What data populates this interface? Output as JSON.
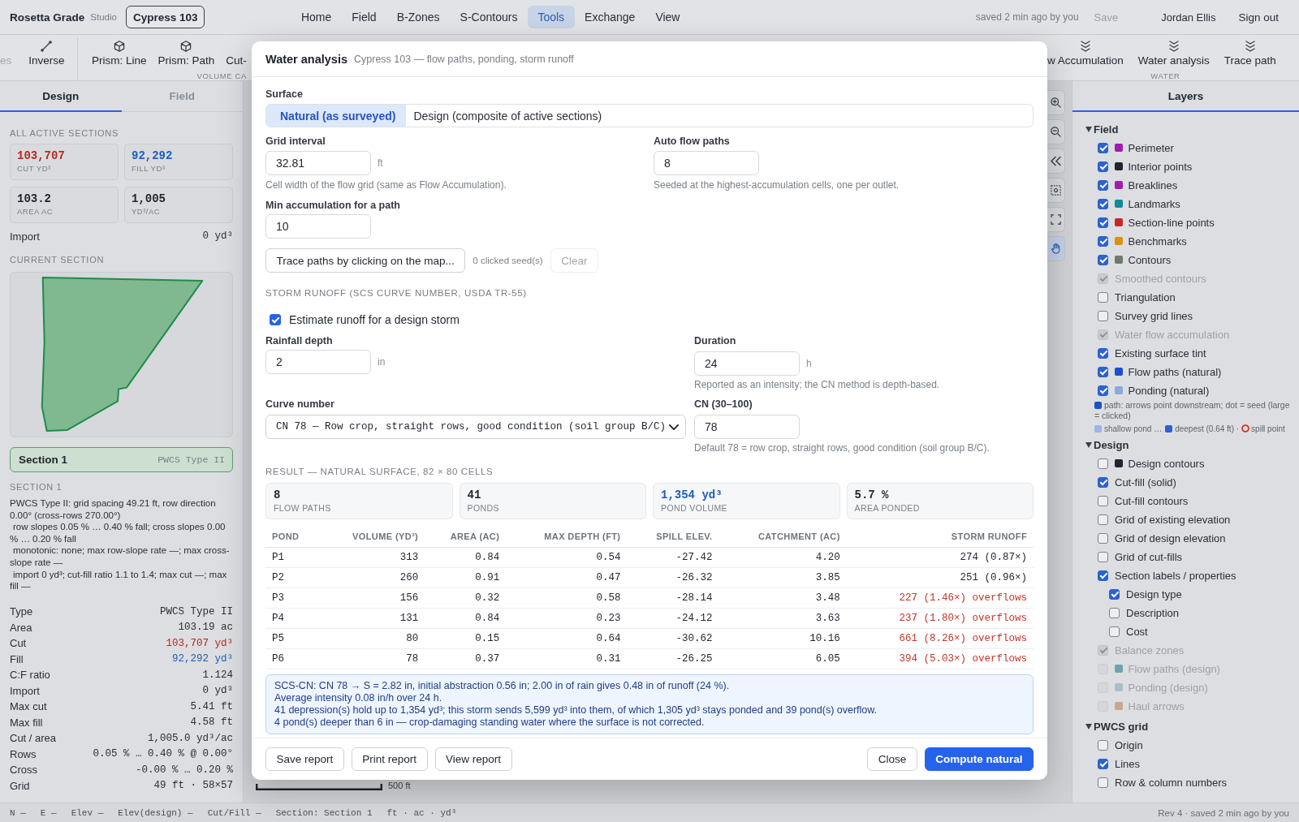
{
  "app": {
    "name": "Rosetta Grade",
    "edition": "Studio",
    "project": "Cypress 103"
  },
  "nav": [
    {
      "label": "Home",
      "selected": false
    },
    {
      "label": "Field",
      "selected": false
    },
    {
      "label": "B-Zones",
      "selected": false
    },
    {
      "label": "S-Contours",
      "selected": false
    },
    {
      "label": "Tools",
      "selected": true
    },
    {
      "label": "Exchange",
      "selected": false
    },
    {
      "label": "View",
      "selected": false
    }
  ],
  "account": {
    "save_status": "saved 2 min ago by you",
    "save": {
      "label": "Save",
      "disabled": true
    },
    "user": "Jordan Ellis",
    "sign_out": "Sign out"
  },
  "toolbar": {
    "groups": [
      {
        "items": [
          {
            "label": "es",
            "kind": "none",
            "disabled": true
          },
          {
            "label": "Inverse",
            "kind": "segment",
            "disabled": false
          }
        ]
      },
      {
        "label": "VOLUME CA",
        "items": [
          {
            "label": "Prism: Line",
            "kind": "prism",
            "disabled": false
          },
          {
            "label": "Prism: Path",
            "kind": "prism",
            "disabled": false
          },
          {
            "label": "Cut-",
            "kind": "none",
            "disabled": false
          }
        ]
      },
      {
        "label": "WATER",
        "items": [
          {
            "label": "w Accumulation",
            "kind": "flow",
            "disabled": false
          },
          {
            "label": "Water analysis",
            "kind": "flow",
            "disabled": false
          },
          {
            "label": "Trace path",
            "kind": "flow",
            "disabled": false
          }
        ]
      }
    ]
  },
  "left_panel": {
    "tabs": [
      {
        "label": "Design",
        "selected": true
      },
      {
        "label": "Field",
        "selected": false
      }
    ],
    "totals_heading": "ALL ACTIVE SECTIONS",
    "totals": [
      {
        "value": "103,707",
        "label": "CUT YD³",
        "kind": "cut"
      },
      {
        "value": "92,292",
        "label": "FILL YD³",
        "kind": "fill"
      },
      {
        "value": "103.2",
        "label": "AREA AC",
        "kind": "plain"
      },
      {
        "value": "1,005",
        "label": "YD³/AC",
        "kind": "plain"
      }
    ],
    "import_total": {
      "label": "Import",
      "value": "0 yd³"
    },
    "current_heading": "CURRENT SECTION",
    "sections": [
      {
        "name": "Section 1",
        "type": "PWCS Type II",
        "selected": true
      }
    ],
    "detail_heading": "SECTION 1",
    "summary_lines": [
      "PWCS Type II: grid spacing 49.21 ft, row direction 0.00° (cross-rows 270.00°)",
      "row slopes 0.05 % … 0.40 % fall; cross slopes 0.00 % … 0.20 % fall",
      "monotonic: none; max row-slope rate —; max cross-slope rate —",
      "import 0 yd³; cut-fill ratio 1.1 to 1.4; max cut —; max fill —"
    ],
    "properties": [
      {
        "label": "Type",
        "value": "PWCS Type II",
        "kind": "plain"
      },
      {
        "label": "Area",
        "value": "103.19 ac",
        "kind": "plain"
      },
      {
        "label": "Cut",
        "value": "103,707 yd³",
        "kind": "cut"
      },
      {
        "label": "Fill",
        "value": "92,292 yd³",
        "kind": "fill"
      },
      {
        "label": "C:F ratio",
        "value": "1.124",
        "kind": "plain"
      },
      {
        "label": "Import",
        "value": "0 yd³",
        "kind": "plain"
      },
      {
        "label": "Max cut",
        "value": "5.41 ft",
        "kind": "plain"
      },
      {
        "label": "Max fill",
        "value": "4.58 ft",
        "kind": "plain"
      },
      {
        "label": "Cut / area",
        "value": "1,005.0 yd³/ac",
        "kind": "plain"
      },
      {
        "label": "Rows",
        "value": "0.05 % … 0.40 % @ 0.00°",
        "kind": "plain"
      },
      {
        "label": "Cross",
        "value": "-0.00 % … 0.20 %",
        "kind": "plain"
      },
      {
        "label": "Grid",
        "value": "49 ft · 58×57",
        "kind": "plain"
      }
    ]
  },
  "map": {
    "controls": [
      {
        "kind": "zoom-in",
        "selected": false
      },
      {
        "kind": "zoom-out",
        "selected": false
      },
      {
        "kind": "collapse",
        "selected": false
      },
      {
        "kind": "box-select",
        "selected": false
      },
      {
        "kind": "fit",
        "selected": false
      },
      {
        "kind": "pan",
        "selected": true
      }
    ],
    "scale": "500 ft"
  },
  "dialog": {
    "title": "Water analysis",
    "subtitle": "Cypress 103 — flow paths, ponding, storm runoff",
    "surface": {
      "label": "Surface",
      "options": [
        {
          "label": "Natural (as surveyed)",
          "selected": true
        },
        {
          "label": "Design (composite of active sections)",
          "selected": false
        }
      ]
    },
    "grid_interval": {
      "label": "Grid interval",
      "value": "32.81",
      "unit": "ft",
      "help": "Cell width of the flow grid (same as Flow Accumulation)."
    },
    "auto_flow_paths": {
      "label": "Auto flow paths",
      "value": "8",
      "help": "Seeded at the highest-accumulation cells, one per outlet."
    },
    "min_accumulation": {
      "label": "Min accumulation for a path",
      "value": "10"
    },
    "trace": {
      "button": "Trace paths by clicking on the map...",
      "seed_count": "0 clicked seed(s)",
      "clear": {
        "label": "Clear",
        "disabled": true
      }
    },
    "storm_heading": "STORM RUNOFF (SCS CURVE NUMBER, USDA TR-55)",
    "estimate": {
      "label": "Estimate runoff for a design storm",
      "checked": true
    },
    "rainfall": {
      "label": "Rainfall depth",
      "value": "2",
      "unit": "in"
    },
    "duration": {
      "label": "Duration",
      "value": "24",
      "unit": "h",
      "help": "Reported as an intensity; the CN method is depth-based."
    },
    "curve_number": {
      "label": "Curve number",
      "value": "CN 78 — Row crop, straight rows, good condition (soil group B/C)"
    },
    "cn": {
      "label": "CN (30–100)",
      "value": "78",
      "help": "Default 78 = row crop, straight rows, good condition (soil group B/C)."
    },
    "result_heading": "RESULT — NATURAL SURFACE, 82 × 80 CELLS",
    "result_stats": [
      {
        "value": "8",
        "label": "FLOW PATHS",
        "kind": "plain"
      },
      {
        "value": "41",
        "label": "PONDS",
        "kind": "plain"
      },
      {
        "value": "1,354 yd³",
        "label": "POND VOLUME",
        "kind": "fill"
      },
      {
        "value": "5.7 %",
        "label": "AREA PONDED",
        "kind": "plain"
      }
    ],
    "table": {
      "columns": [
        "POND",
        "VOLUME (YD³)",
        "AREA (AC)",
        "MAX DEPTH (FT)",
        "SPILL ELEV.",
        "CATCHMENT (AC)",
        "STORM RUNOFF"
      ],
      "rows": [
        {
          "cells": [
            "P1",
            "313",
            "0.84",
            "0.54",
            "-27.42",
            "4.20",
            "274 (0.87×)"
          ],
          "overflow": false
        },
        {
          "cells": [
            "P2",
            "260",
            "0.91",
            "0.47",
            "-26.32",
            "3.85",
            "251 (0.96×)"
          ],
          "overflow": false
        },
        {
          "cells": [
            "P3",
            "156",
            "0.32",
            "0.58",
            "-28.14",
            "3.48",
            "227 (1.46×) overflows"
          ],
          "overflow": true
        },
        {
          "cells": [
            "P4",
            "131",
            "0.84",
            "0.23",
            "-24.12",
            "3.63",
            "237 (1.80×) overflows"
          ],
          "overflow": true
        },
        {
          "cells": [
            "P5",
            "80",
            "0.15",
            "0.64",
            "-30.62",
            "10.16",
            "661 (8.26×) overflows"
          ],
          "overflow": true
        },
        {
          "cells": [
            "P6",
            "78",
            "0.37",
            "0.31",
            "-26.25",
            "6.05",
            "394 (5.03×) overflows"
          ],
          "overflow": true
        }
      ]
    },
    "note": [
      "SCS-CN: CN 78 → S = 2.82 in, initial abstraction 0.56 in; 2.00 in of rain gives 0.48 in of runoff (24 %).",
      "Average intensity 0.08 in/h over 24 h.",
      "41 depression(s) hold up to 1,354 yd³; this storm sends 5,599 yd³ into them, of which 1,305 yd³ stays ponded and 39 pond(s) overflow.",
      "4 pond(s) deeper than 6 in — crop-damaging standing water where the surface is not corrected."
    ],
    "footer": {
      "left": [
        {
          "label": "Save report",
          "kind": "secondary"
        },
        {
          "label": "Print report",
          "kind": "secondary"
        },
        {
          "label": "View report",
          "kind": "secondary"
        }
      ],
      "right": [
        {
          "label": "Close",
          "kind": "secondary"
        },
        {
          "label": "Compute natural",
          "kind": "primary"
        }
      ]
    }
  },
  "layers_panel": {
    "title": "Layers",
    "groups": [
      {
        "label": "Field",
        "expanded": true,
        "items": [
          {
            "label": "Perimeter",
            "checked": true,
            "disabled": false,
            "color": "#a21caf"
          },
          {
            "label": "Interior points",
            "checked": true,
            "disabled": false,
            "color": "#1f2430"
          },
          {
            "label": "Breaklines",
            "checked": true,
            "disabled": false,
            "color": "#a21caf"
          },
          {
            "label": "Landmarks",
            "checked": true,
            "disabled": false,
            "color": "#0f8b99"
          },
          {
            "label": "Section-line points",
            "checked": true,
            "disabled": false,
            "color": "#c62828"
          },
          {
            "label": "Benchmarks",
            "checked": true,
            "disabled": false,
            "color": "#d69413"
          },
          {
            "label": "Contours",
            "checked": true,
            "disabled": false,
            "color": "#6e7b6c"
          },
          {
            "label": "Smoothed contours",
            "checked": true,
            "disabled": true
          },
          {
            "label": "Triangulation",
            "checked": false,
            "disabled": false
          },
          {
            "label": "Survey grid lines",
            "checked": false,
            "disabled": false
          },
          {
            "label": "Water flow accumulation",
            "checked": true,
            "disabled": true
          },
          {
            "label": "Existing surface tint",
            "checked": true,
            "disabled": false
          },
          {
            "label": "Flow paths (natural)",
            "checked": true,
            "disabled": false,
            "color": "#1e4fd0"
          },
          {
            "label": "Ponding (natural)",
            "checked": true,
            "disabled": false,
            "color": "#8ea7df"
          }
        ],
        "legend": [
          {
            "entries": [
              {
                "kind": "square",
                "color": "#1e4fd0",
                "text": "path: arrows point downstream; dot = seed (large = clicked)"
              }
            ]
          },
          {
            "entries": [
              {
                "kind": "square",
                "color": "#9db4e4",
                "text": "shallow pond …"
              },
              {
                "kind": "square",
                "color": "#2f5fd8",
                "text": "deepest (0.64 ft) ·"
              },
              {
                "kind": "ring",
                "color": "#d92d20",
                "text": "spill point"
              }
            ]
          }
        ]
      },
      {
        "label": "Design",
        "expanded": true,
        "items": [
          {
            "label": "Design contours",
            "checked": false,
            "disabled": false,
            "color": "#1f2430"
          },
          {
            "label": "Cut-fill (solid)",
            "checked": true,
            "disabled": false
          },
          {
            "label": "Cut-fill contours",
            "checked": false,
            "disabled": false
          },
          {
            "label": "Grid of existing elevation",
            "checked": false,
            "disabled": false
          },
          {
            "label": "Grid of design elevation",
            "checked": false,
            "disabled": false
          },
          {
            "label": "Grid of cut-fills",
            "checked": false,
            "disabled": false
          },
          {
            "label": "Section labels / properties",
            "checked": true,
            "disabled": false,
            "children": [
              {
                "label": "Design type",
                "checked": true,
                "disabled": false
              },
              {
                "label": "Description",
                "checked": false,
                "disabled": false
              },
              {
                "label": "Cost",
                "checked": false,
                "disabled": false
              }
            ]
          },
          {
            "label": "Balance zones",
            "checked": true,
            "disabled": true
          },
          {
            "label": "Flow paths (design)",
            "checked": false,
            "disabled": true,
            "color": "#6fa3ac"
          },
          {
            "label": "Ponding (design)",
            "checked": false,
            "disabled": true,
            "color": "#a9bdca"
          },
          {
            "label": "Haul arrows",
            "checked": false,
            "disabled": true,
            "color": "#c7a98c"
          }
        ]
      },
      {
        "label": "PWCS grid",
        "expanded": true,
        "items": [
          {
            "label": "Origin",
            "checked": false,
            "disabled": false
          },
          {
            "label": "Lines",
            "checked": true,
            "disabled": false
          },
          {
            "label": "Row & column numbers",
            "checked": false,
            "disabled": false
          }
        ]
      }
    ]
  },
  "status_bar": {
    "items": [
      "N —",
      "E —",
      "Elev —",
      "Elev(design) —",
      "Cut/Fill —",
      "Section: Section 1",
      "ft · ac · yd³"
    ],
    "revision": "Rev 4 · saved 2 min ago by you"
  }
}
